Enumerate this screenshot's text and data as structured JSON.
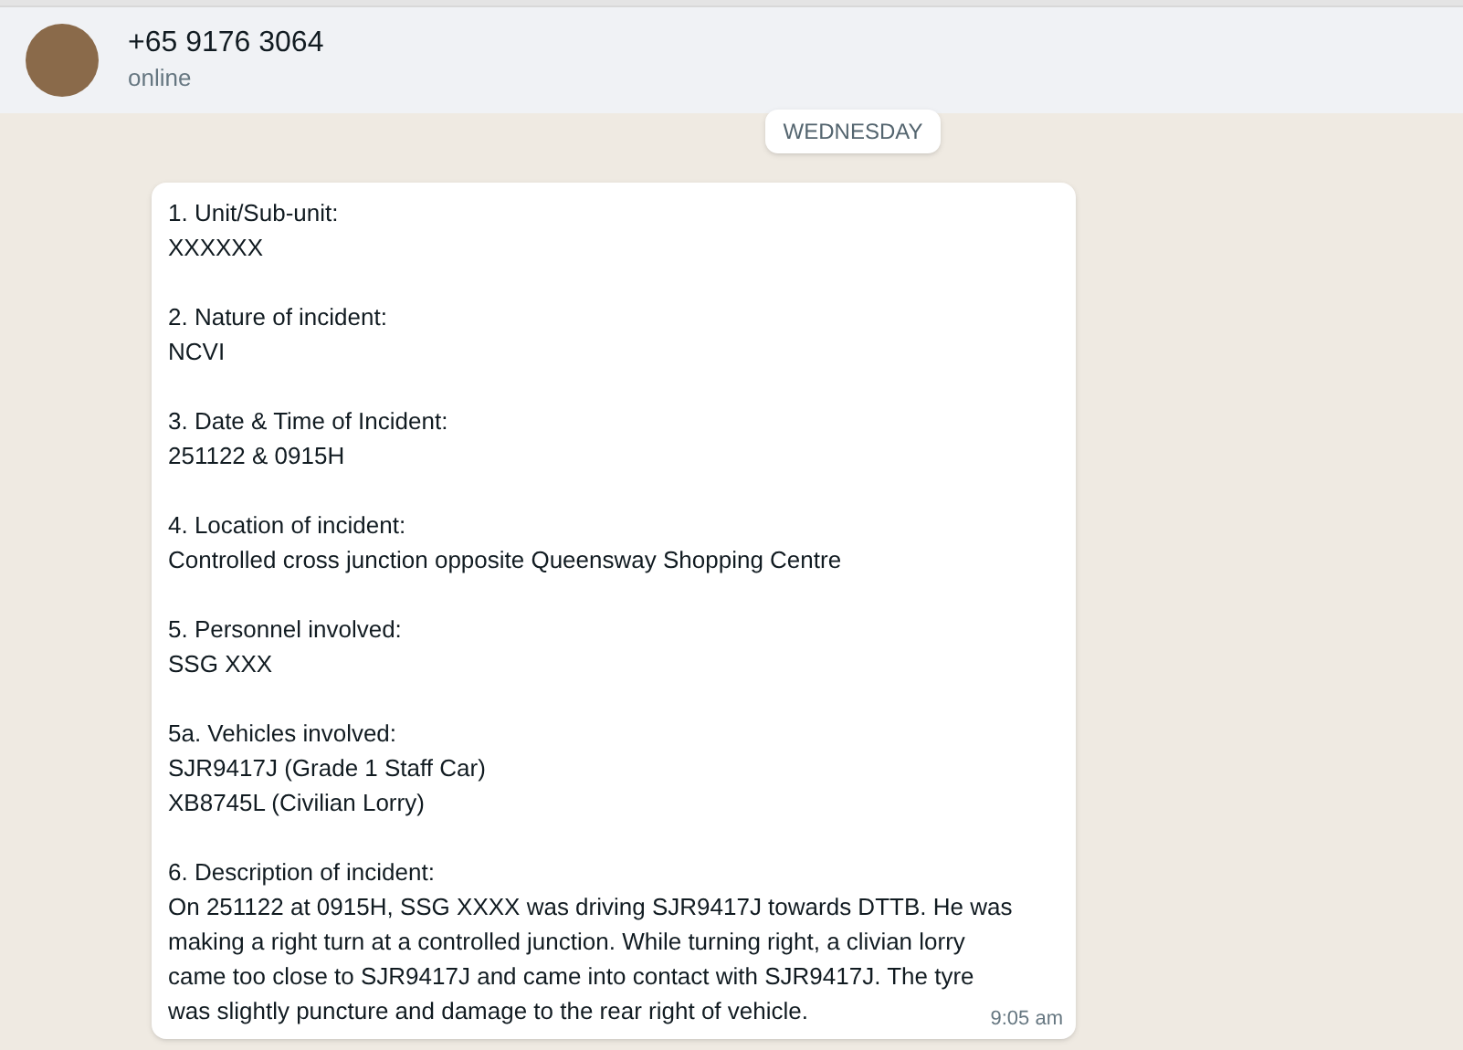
{
  "header": {
    "name": "+65 9176 3064",
    "status": "online"
  },
  "date_divider": "WEDNESDAY",
  "message": {
    "sections": [
      {
        "heading": "1. Unit/Sub-unit:",
        "lines": [
          "XXXXXX"
        ]
      },
      {
        "heading": "2. Nature of incident:",
        "lines": [
          "NCVI"
        ]
      },
      {
        "heading": "3. Date & Time of Incident:",
        "lines": [
          "251122 & 0915H"
        ]
      },
      {
        "heading": "4. Location of incident:",
        "lines": [
          "Controlled cross junction opposite Queensway Shopping Centre"
        ]
      },
      {
        "heading": "5. Personnel involved:",
        "lines": [
          "SSG XXX"
        ]
      },
      {
        "heading": "5a. Vehicles involved:",
        "lines": [
          "SJR9417J (Grade 1 Staff Car)",
          "XB8745L (Civilian Lorry)"
        ]
      },
      {
        "heading": "6. Description of incident:",
        "lines": [
          "On 251122 at 0915H, SSG XXXX was driving SJR9417J towards DTTB. He was",
          "making a right turn at a controlled junction. While turning right, a clivian lorry",
          "came too close to SJR9417J and came into contact with SJR9417J. The tyre",
          "was slightly puncture and damage to the rear right of vehicle."
        ]
      }
    ],
    "time": "9:05 am"
  }
}
